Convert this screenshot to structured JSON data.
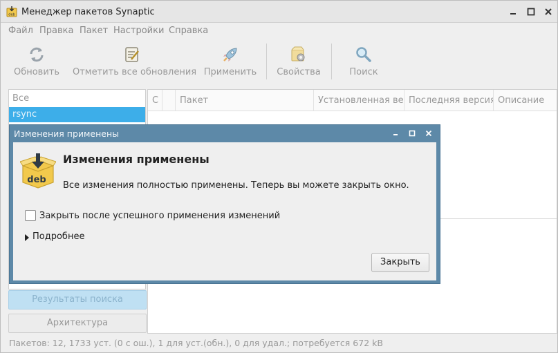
{
  "window": {
    "title": "Менеджер пакетов Synaptic"
  },
  "menubar": {
    "items": [
      "Файл",
      "Правка",
      "Пакет",
      "Настройки",
      "Справка"
    ]
  },
  "toolbar": {
    "reload": "Обновить",
    "mark_all": "Отметить все обновления",
    "apply": "Применить",
    "properties": "Свойства",
    "search": "Поиск"
  },
  "filters": {
    "items": [
      "Все",
      "rsync"
    ],
    "selected": "rsync"
  },
  "left_buttons": {
    "search_results": "Результаты поиска",
    "architecture": "Архитектура"
  },
  "package_table": {
    "columns": [
      "С",
      "Пакет",
      "Установленная версия",
      "Последняя версия",
      "Описание"
    ]
  },
  "statusbar": {
    "text": "Пакетов: 12, 1733 уст. (0 с ош.), 1 для уст.(обн.), 0 для удал.; потребуется 672 kB"
  },
  "dialog": {
    "title": "Изменения применены",
    "heading": "Изменения применены",
    "message": "Все изменения полностью применены. Теперь вы можете закрыть окно.",
    "checkbox_label": "Закрыть после успешного применения изменений",
    "checkbox_checked": false,
    "expander_label": "Подробнее",
    "close_button": "Закрыть",
    "icon_text": "deb"
  },
  "colors": {
    "accent": "#3daee9",
    "dialog_frame": "#5d89a8",
    "deb_box": "#f2c94c"
  }
}
